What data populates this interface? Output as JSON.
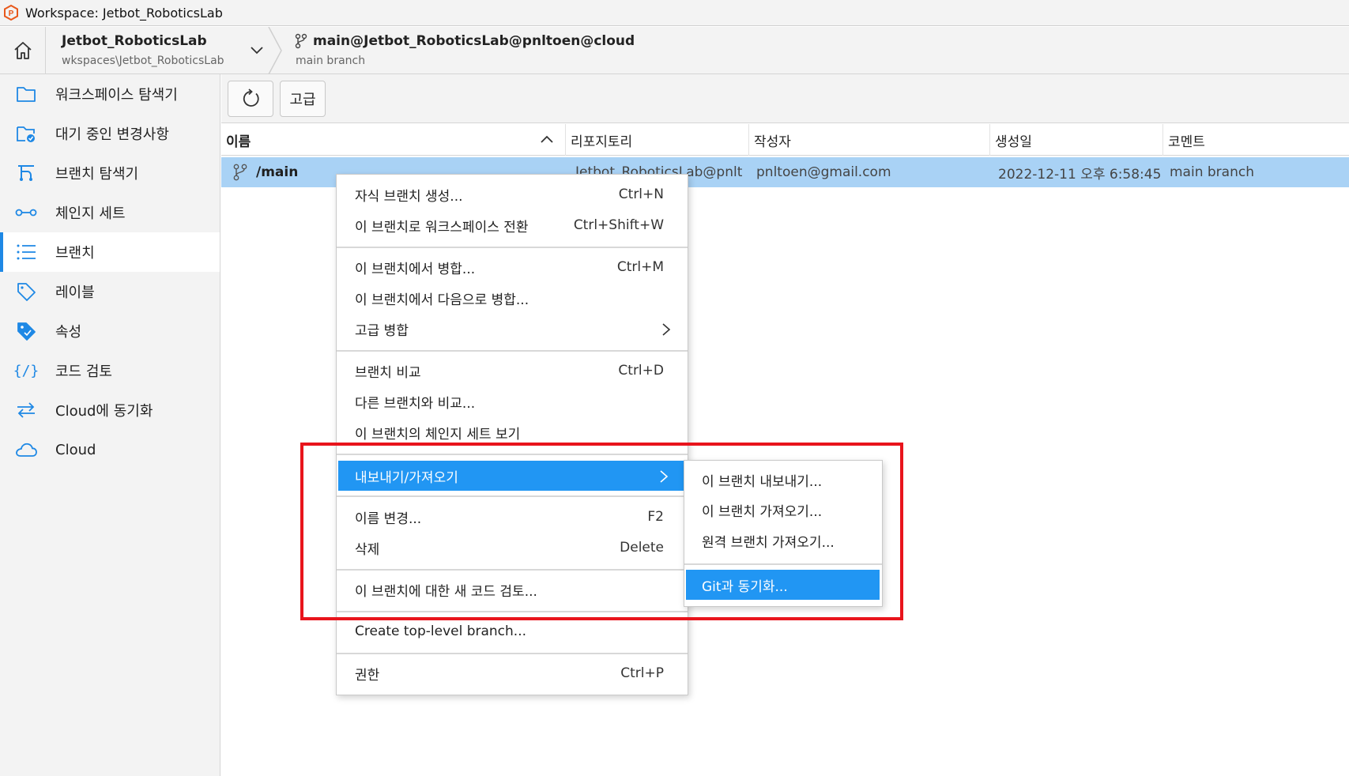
{
  "window": {
    "title": "Workspace: Jetbot_RoboticsLab"
  },
  "header": {
    "workspace_name": "Jetbot_RoboticsLab",
    "workspace_path": "wkspaces\\Jetbot_RoboticsLab",
    "branch_full": "main@Jetbot_RoboticsLab@pnltoen@cloud",
    "branch_sub": "main branch"
  },
  "sidebar": {
    "items": [
      {
        "label": "워크스페이스 탐색기",
        "icon": "folder-icon"
      },
      {
        "label": "대기 중인 변경사항",
        "icon": "pending-changes-icon"
      },
      {
        "label": "브랜치 탐색기",
        "icon": "branch-explorer-icon"
      },
      {
        "label": "체인지 세트",
        "icon": "changeset-icon"
      },
      {
        "label": "브랜치",
        "icon": "list-icon",
        "active": true
      },
      {
        "label": "레이블",
        "icon": "label-icon"
      },
      {
        "label": "속성",
        "icon": "attribute-icon"
      },
      {
        "label": "코드 검토",
        "icon": "code-review-icon"
      },
      {
        "label": "Cloud에 동기화",
        "icon": "sync-icon"
      },
      {
        "label": "Cloud",
        "icon": "cloud-icon"
      }
    ]
  },
  "toolbar": {
    "refresh_icon": "refresh-icon",
    "advanced_label": "고급"
  },
  "table": {
    "columns": [
      "이름",
      "리포지토리",
      "작성자",
      "생성일",
      "코멘트"
    ],
    "rows": [
      {
        "name": "/main",
        "repository": "Jetbot_RoboticsLab@pnlt",
        "author": "pnltoen@gmail.com",
        "created": "2022-12-11 오후 6:58:45",
        "comment": "main branch"
      }
    ]
  },
  "context_menu": {
    "create_child": {
      "label": "자식 브랜치 생성...",
      "shortcut": "Ctrl+N"
    },
    "switch_workspace": {
      "label": "이 브랜치로 워크스페이스 전환",
      "shortcut": "Ctrl+Shift+W"
    },
    "merge_from": {
      "label": "이 브랜치에서 병합...",
      "shortcut": "Ctrl+M"
    },
    "merge_to": {
      "label": "이 브랜치에서 다음으로 병합..."
    },
    "advanced_merge": {
      "label": "고급 병합"
    },
    "diff": {
      "label": "브랜치 비교",
      "shortcut": "Ctrl+D"
    },
    "diff_other": {
      "label": "다른 브랜치와 비교..."
    },
    "view_changesets": {
      "label": "이 브랜치의 체인지 세트 보기"
    },
    "export_import": {
      "label": "내보내기/가져오기"
    },
    "rename": {
      "label": "이름 변경...",
      "shortcut": "F2"
    },
    "delete": {
      "label": "삭제",
      "shortcut": "Delete"
    },
    "new_review": {
      "label": "이 브랜치에 대한 새 코드 검토..."
    },
    "create_top": {
      "label": "Create top-level branch..."
    },
    "permissions": {
      "label": "권한",
      "shortcut": "Ctrl+P"
    }
  },
  "submenu": {
    "export_branch": "이 브랜치 내보내기...",
    "import_branch": "이 브랜치 가져오기...",
    "import_remote": "원격 브랜치 가져오기...",
    "sync_git": "Git과 동기화..."
  },
  "colors": {
    "accent": "#2196f3",
    "selection": "#a9d2f5",
    "highlight_box": "#e8141c"
  }
}
